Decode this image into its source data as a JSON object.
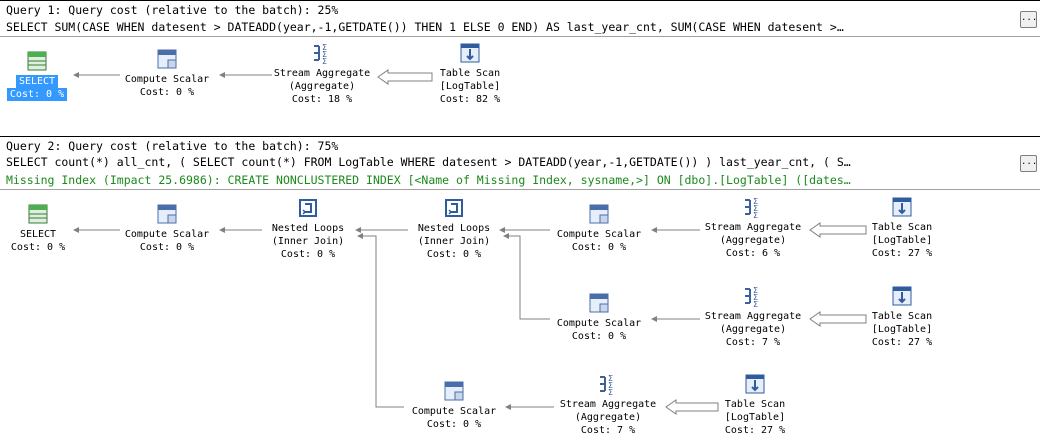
{
  "query1": {
    "cost_line": "Query 1: Query cost (relative to the batch): 25%",
    "sql_line": "SELECT SUM(CASE WHEN datesent > DATEADD(year,-1,GETDATE()) THEN 1 ELSE 0 END) AS last_year_cnt, SUM(CASE WHEN datesent >…",
    "more_label": "...",
    "nodes": {
      "select": {
        "title": "SELECT",
        "cost": "Cost: 0 %"
      },
      "compute": {
        "title": "Compute Scalar",
        "cost": "Cost: 0 %"
      },
      "stream": {
        "title": "Stream Aggregate",
        "sub": "(Aggregate)",
        "cost": "Cost: 18 %"
      },
      "scan": {
        "title": "Table Scan",
        "sub": "[LogTable]",
        "cost": "Cost: 82 %"
      }
    }
  },
  "query2": {
    "cost_line": "Query 2: Query cost (relative to the batch): 75%",
    "sql_line": "SELECT count(*) all_cnt, ( SELECT count(*) FROM LogTable WHERE datesent > DATEADD(year,-1,GETDATE()) ) last_year_cnt, ( S…",
    "missing_index": "Missing Index (Impact 25.6986): CREATE NONCLUSTERED INDEX [<Name of Missing Index, sysname,>] ON [dbo].[LogTable] ([dates…",
    "more_label": "...",
    "nodes": {
      "select": {
        "title": "SELECT",
        "cost": "Cost: 0 %"
      },
      "compute1": {
        "title": "Compute Scalar",
        "cost": "Cost: 0 %"
      },
      "nl1": {
        "title": "Nested Loops",
        "sub": "(Inner Join)",
        "cost": "Cost: 0 %"
      },
      "nl2": {
        "title": "Nested Loops",
        "sub": "(Inner Join)",
        "cost": "Cost: 0 %"
      },
      "compute_a": {
        "title": "Compute Scalar",
        "cost": "Cost: 0 %"
      },
      "stream_a": {
        "title": "Stream Aggregate",
        "sub": "(Aggregate)",
        "cost": "Cost: 6 %"
      },
      "scan_a": {
        "title": "Table Scan",
        "sub": "[LogTable]",
        "cost": "Cost: 27 %"
      },
      "compute_b": {
        "title": "Compute Scalar",
        "cost": "Cost: 0 %"
      },
      "stream_b": {
        "title": "Stream Aggregate",
        "sub": "(Aggregate)",
        "cost": "Cost: 7 %"
      },
      "scan_b": {
        "title": "Table Scan",
        "sub": "[LogTable]",
        "cost": "Cost: 27 %"
      },
      "compute_c": {
        "title": "Compute Scalar",
        "cost": "Cost: 0 %"
      },
      "stream_c": {
        "title": "Stream Aggregate",
        "sub": "(Aggregate)",
        "cost": "Cost: 7 %"
      },
      "scan_c": {
        "title": "Table Scan",
        "sub": "[LogTable]",
        "cost": "Cost: 27 %"
      }
    }
  },
  "icons": [
    "select-icon",
    "compute-scalar-icon",
    "stream-aggregate-icon",
    "table-scan-icon",
    "nested-loops-icon"
  ],
  "colors": {
    "selection": "#3399ff",
    "missing_index": "#1a8a1a",
    "arrow": "#808080"
  }
}
